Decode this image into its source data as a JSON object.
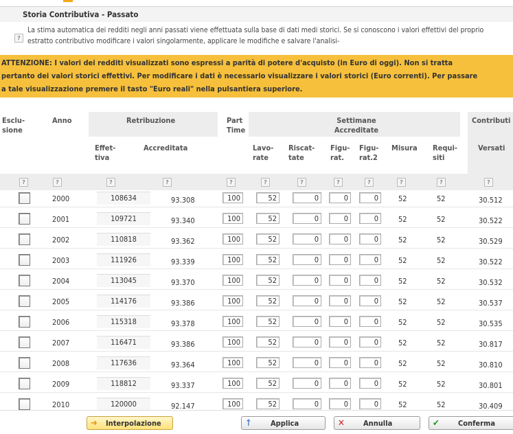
{
  "panel": {
    "title": "Storia Contributiva - Passato"
  },
  "info": {
    "line1": "La stima automatica dei redditi negli anni passati viene effettuata sulla base di dati medi storici. Se si conoscono i valori effettivi del proprio",
    "line2": "estratto contributivo modificare i valori singolarmente, applicare le modifiche e salvare l'analisi-"
  },
  "warning": {
    "line1": "ATTENZIONE: I valori dei redditi visualizzati sono espressi a parità di potere d'acquisto (in Euro di oggi). Non si tratta",
    "line2": "pertanto dei valori storici effettivi. Per modificare i dati è necessario visualizzare i valori storici (Euro correnti). Per passare",
    "line3": "a tale visualizzazione premere il tasto \"Euro reali\" nella pulsantiera superiore."
  },
  "headers": {
    "esclusione_1": "Esclu-",
    "esclusione_2": "sione",
    "anno": "Anno",
    "retribuzione": "Retribuzione",
    "effettiva_1": "Effet-",
    "effettiva_2": "tiva",
    "accreditata": "Accreditata",
    "part_1": "Part",
    "part_2": "Time",
    "settimane_1": "Settimane",
    "settimane_2": "Accreditate",
    "lavorate_1": "Lavo-",
    "lavorate_2": "rate",
    "riscattate_1": "Riscat-",
    "riscattate_2": "tate",
    "figurat_1": "Figu-",
    "figurat_2": "rat.",
    "figurat2_1": "Figu-",
    "figurat2_2": "rat.2",
    "misura": "Misura",
    "requisiti_1": "Requi-",
    "requisiti_2": "siti",
    "contributi": "Contributi",
    "versati": "Versati"
  },
  "help_symbol": "?",
  "rows": [
    {
      "anno": "2000",
      "effettiva": "108634",
      "accreditata": "93.308",
      "part": "100",
      "lavorate": "52",
      "riscattate": "0",
      "figurat": "0",
      "figurat2": "0",
      "misura": "52",
      "requisiti": "52",
      "versati": "30.512"
    },
    {
      "anno": "2001",
      "effettiva": "109721",
      "accreditata": "93.340",
      "part": "100",
      "lavorate": "52",
      "riscattate": "0",
      "figurat": "0",
      "figurat2": "0",
      "misura": "52",
      "requisiti": "52",
      "versati": "30.522"
    },
    {
      "anno": "2002",
      "effettiva": "110818",
      "accreditata": "93.362",
      "part": "100",
      "lavorate": "52",
      "riscattate": "0",
      "figurat": "0",
      "figurat2": "0",
      "misura": "52",
      "requisiti": "52",
      "versati": "30.529"
    },
    {
      "anno": "2003",
      "effettiva": "111926",
      "accreditata": "93.339",
      "part": "100",
      "lavorate": "52",
      "riscattate": "0",
      "figurat": "0",
      "figurat2": "0",
      "misura": "52",
      "requisiti": "52",
      "versati": "30.522"
    },
    {
      "anno": "2004",
      "effettiva": "113045",
      "accreditata": "93.370",
      "part": "100",
      "lavorate": "52",
      "riscattate": "0",
      "figurat": "0",
      "figurat2": "0",
      "misura": "52",
      "requisiti": "52",
      "versati": "30.532"
    },
    {
      "anno": "2005",
      "effettiva": "114176",
      "accreditata": "93.386",
      "part": "100",
      "lavorate": "52",
      "riscattate": "0",
      "figurat": "0",
      "figurat2": "0",
      "misura": "52",
      "requisiti": "52",
      "versati": "30.537"
    },
    {
      "anno": "2006",
      "effettiva": "115318",
      "accreditata": "93.378",
      "part": "100",
      "lavorate": "52",
      "riscattate": "0",
      "figurat": "0",
      "figurat2": "0",
      "misura": "52",
      "requisiti": "52",
      "versati": "30.535"
    },
    {
      "anno": "2007",
      "effettiva": "116471",
      "accreditata": "93.386",
      "part": "100",
      "lavorate": "52",
      "riscattate": "0",
      "figurat": "0",
      "figurat2": "0",
      "misura": "52",
      "requisiti": "52",
      "versati": "30.817"
    },
    {
      "anno": "2008",
      "effettiva": "117636",
      "accreditata": "93.364",
      "part": "100",
      "lavorate": "52",
      "riscattate": "0",
      "figurat": "0",
      "figurat2": "0",
      "misura": "52",
      "requisiti": "52",
      "versati": "30.810"
    },
    {
      "anno": "2009",
      "effettiva": "118812",
      "accreditata": "93.337",
      "part": "100",
      "lavorate": "52",
      "riscattate": "0",
      "figurat": "0",
      "figurat2": "0",
      "misura": "52",
      "requisiti": "52",
      "versati": "30.801"
    },
    {
      "anno": "2010",
      "effettiva": "120000",
      "accreditata": "92.147",
      "part": "100",
      "lavorate": "52",
      "riscattate": "0",
      "figurat": "0",
      "figurat2": "0",
      "misura": "52",
      "requisiti": "52",
      "versati": "30.409"
    }
  ],
  "buttons": {
    "interpolazione": "Interpolazione",
    "applica": "Applica",
    "annulla": "Annulla",
    "conferma": "Conferma"
  },
  "icons": {
    "interpolazione": "arrow-right-icon",
    "applica": "arrow-up-icon",
    "annulla": "x-icon",
    "conferma": "check-icon"
  },
  "colors": {
    "warning_bg": "#f6c03c",
    "accent": "#f2a91b",
    "header_shade": "#ededed"
  }
}
